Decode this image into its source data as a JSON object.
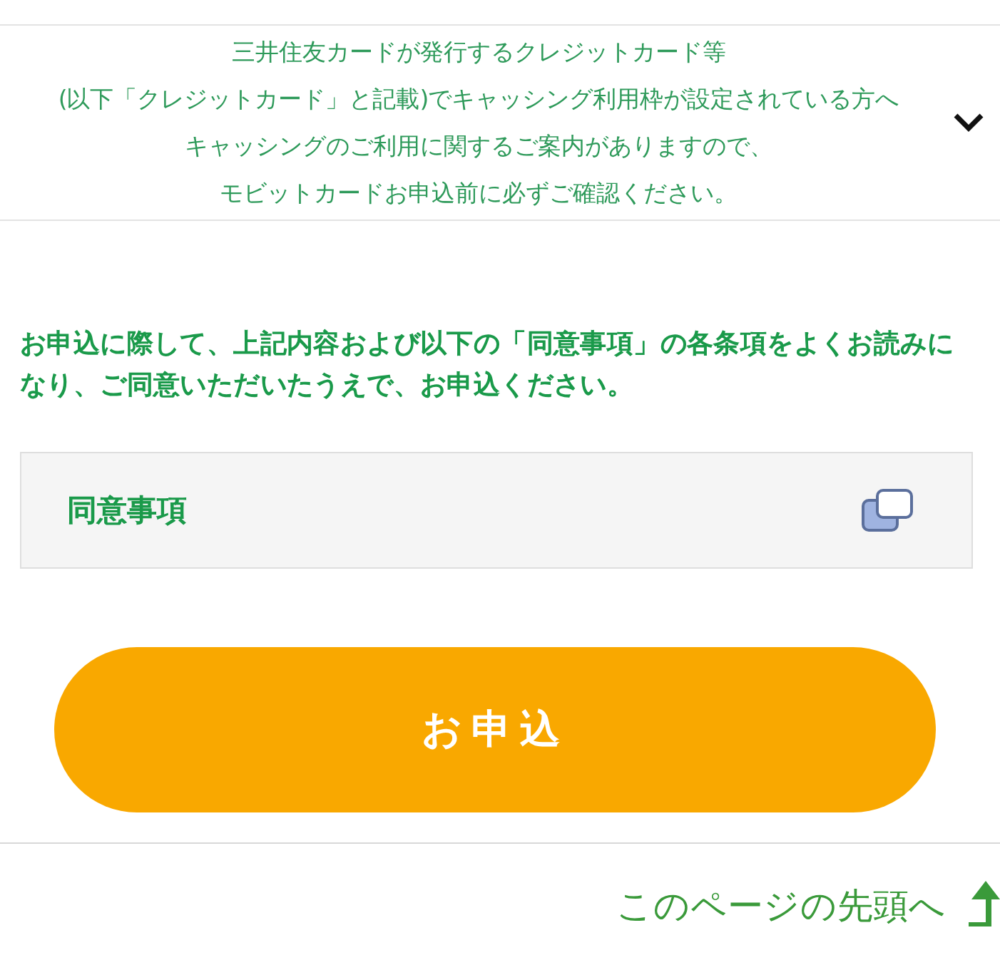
{
  "notice": {
    "lines": [
      "三井住友カードが発行するクレジットカード等",
      "(以下「クレジットカード」と記載)でキャッシング利用枠が設定されている方へ",
      "キャッシングのご利用に関するご案内がありますので、",
      "モビットカードお申込前に必ずご確認ください。"
    ],
    "expanded": false
  },
  "instruction": "お申込に際して、上記内容および以下の「同意事項」の各条項をよくお読みになり、ご同意いただいたうえで、お申込ください。",
  "agreement": {
    "label": "同意事項"
  },
  "apply_button": "お申込",
  "page_top_link": "このページの先頭へ"
}
